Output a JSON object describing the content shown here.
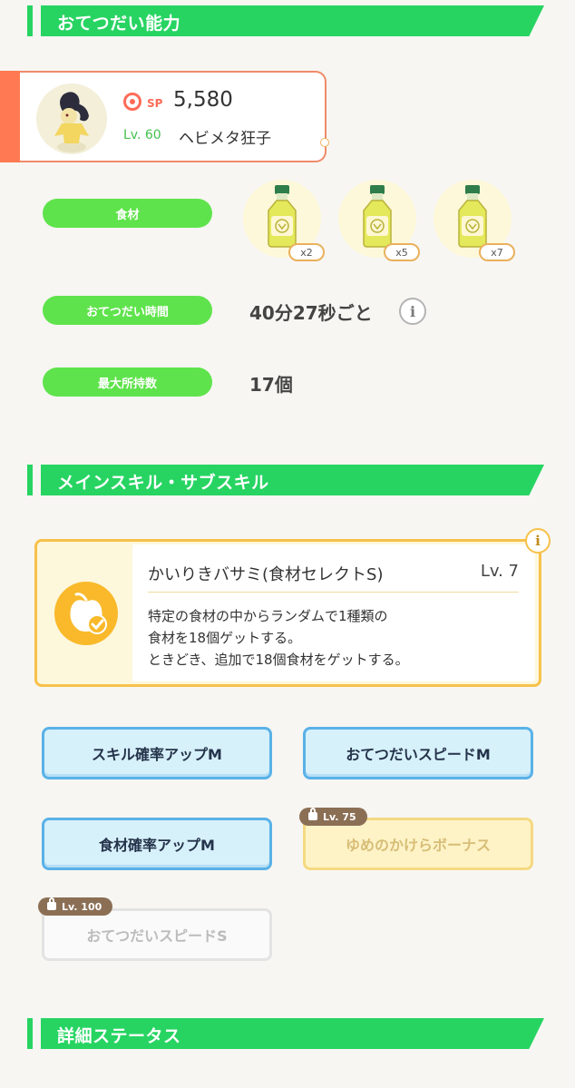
{
  "sections": {
    "help_ability": "おてつだい能力",
    "main_sub_skill": "メインスキル・サブスキル",
    "detail_status": "詳細ステータス"
  },
  "pokemon": {
    "sp_label": "SP",
    "sp_value": "5,580",
    "level": "Lv. 60",
    "nickname": "ヘビメタ狂子",
    "avatar_icon": "mawile-icon"
  },
  "ingredients": {
    "label": "食材",
    "items": [
      {
        "icon": "oil-bottle-icon",
        "qty": "x2"
      },
      {
        "icon": "oil-bottle-icon",
        "qty": "x5"
      },
      {
        "icon": "oil-bottle-icon",
        "qty": "x7"
      }
    ]
  },
  "help_time": {
    "label": "おてつだい時間",
    "value": "40分27秒ごと"
  },
  "max_carry": {
    "label": "最大所持数",
    "value": "17個"
  },
  "main_skill": {
    "name": "かいりきバサミ(食材セレクトS)",
    "level": "Lv. 7",
    "desc_line1": "特定の食材の中からランダムで1種類の",
    "desc_line2": "食材を18個ゲットする。",
    "desc_line3": "ときどき、追加で18個食材をゲットする。",
    "icon": "apple-check-icon"
  },
  "sub_skills": [
    {
      "label": "スキル確率アップM",
      "state": "active"
    },
    {
      "label": "おてつだいスピードM",
      "state": "active"
    },
    {
      "label": "食材確率アップM",
      "state": "active"
    },
    {
      "label": "ゆめのかけらボーナス",
      "state": "locked",
      "lock_level": "Lv. 75"
    },
    {
      "label": "おてつだいスピードS",
      "state": "locked",
      "lock_level": "Lv. 100"
    }
  ],
  "colors": {
    "banner_green": "#27d462",
    "pill_green": "#5fe34c",
    "accent_orange": "#ff7a52",
    "skill_gold": "#f7c14a",
    "active_blue": "#5ab2e8"
  }
}
